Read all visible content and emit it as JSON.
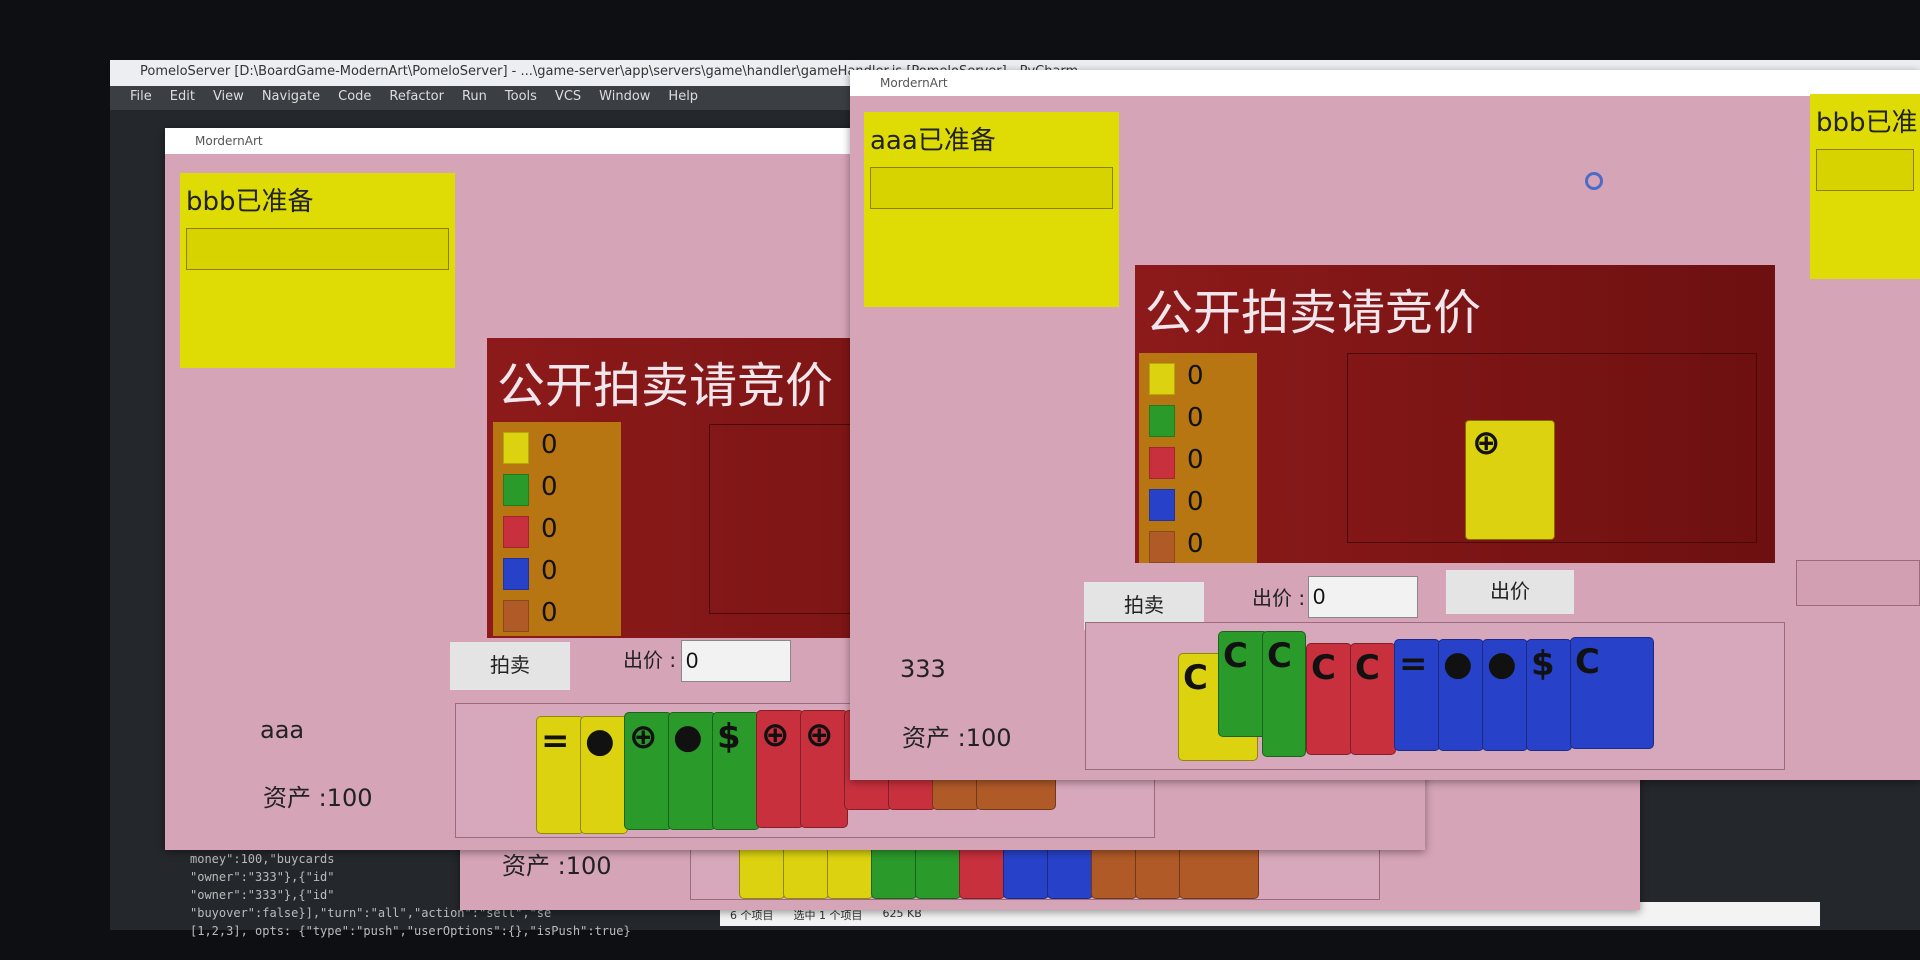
{
  "ide": {
    "title": "PomeloServer [D:\\BoardGame-ModernArt\\PomeloServer] - ...\\game-server\\app\\servers\\game\\handler\\gameHandler.js [PomeloServer] - PyCharm",
    "menu": [
      "File",
      "Edit",
      "View",
      "Navigate",
      "Code",
      "Refactor",
      "Run",
      "Tools",
      "VCS",
      "Window",
      "Help"
    ],
    "code_lines": [
      "money\":100,\"buycards",
      "\"owner\":\"333\"},{\"id\"",
      "\"owner\":\"333\"},{\"id\"",
      "\"buyover\":false}],\"turn\":\"all\",\"action\":\"sell\",\"se",
      "[1,2,3], opts: {\"type\":\"push\",\"userOptions\":{},\"isPush\":true}"
    ],
    "status": {
      "items": "6 个项目",
      "selected": "选中 1 个项目",
      "size": "625 KB"
    }
  },
  "colors": {
    "yellow": "#dcd20f",
    "green": "#2a9a2a",
    "red": "#c8303e",
    "blue": "#2742c9",
    "brown": "#b05a28"
  },
  "legend_icons": [
    "yellow-square-icon",
    "green-square-icon",
    "red-square-icon",
    "blue-square-icon",
    "brown-square-icon"
  ],
  "window_left": {
    "title": "MordernArt",
    "ready_label": "bbb已准备",
    "auction_title": "公开拍卖请竞价",
    "legend_counts": [
      "0",
      "0",
      "0",
      "0",
      "0"
    ],
    "auction_card_symbol": "⊕",
    "sell_button": "拍卖",
    "bid_label": "出价 :",
    "bid_value": "0",
    "player_name": "aaa",
    "asset": "资产 :100",
    "hand": [
      {
        "color": "yellow",
        "symbol": "="
      },
      {
        "color": "yellow",
        "symbol": "●"
      },
      {
        "color": "green",
        "symbol": "⊕"
      },
      {
        "color": "green",
        "symbol": "●"
      },
      {
        "color": "green",
        "symbol": "$"
      },
      {
        "color": "red",
        "symbol": "⊕"
      },
      {
        "color": "red",
        "symbol": "⊕"
      }
    ]
  },
  "window_back": {
    "asset": "资产 :100"
  },
  "window_right": {
    "title": "MordernArt",
    "ready_label": "aaa已准备",
    "ready_label_other": "bbb已准",
    "auction_title": "公开拍卖请竞价",
    "legend_counts": [
      "0",
      "0",
      "0",
      "0",
      "0"
    ],
    "auction_card_symbol": "⊕",
    "sell_button": "拍卖",
    "bid_label": "出价 :",
    "bid_value": "0",
    "bid_button": "出价",
    "player_name": "333",
    "asset": "资产 :100",
    "hand": [
      {
        "color": "yellow",
        "symbol": "C"
      },
      {
        "color": "green",
        "symbol": "C"
      },
      {
        "color": "green",
        "symbol": "C"
      },
      {
        "color": "red",
        "symbol": "C"
      },
      {
        "color": "red",
        "symbol": "C"
      },
      {
        "color": "blue",
        "symbol": "="
      },
      {
        "color": "blue",
        "symbol": "●"
      },
      {
        "color": "blue",
        "symbol": "●"
      },
      {
        "color": "blue",
        "symbol": "$"
      },
      {
        "color": "blue",
        "symbol": "C"
      }
    ]
  }
}
